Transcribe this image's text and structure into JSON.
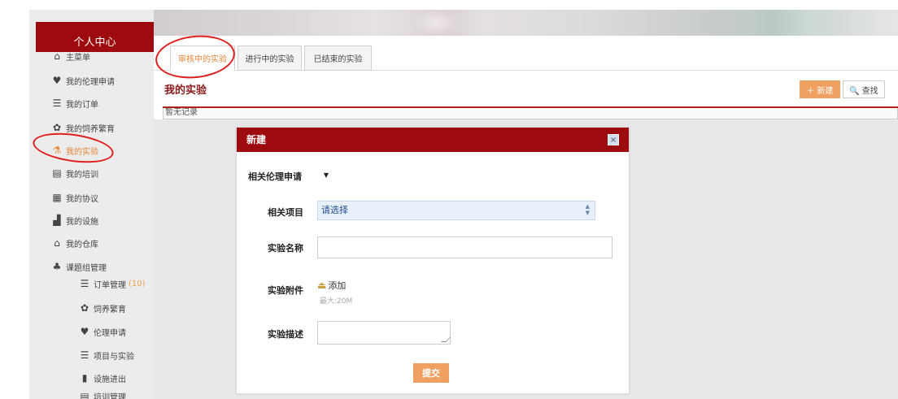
{
  "sidebar": {
    "title": "个人中心",
    "items": [
      {
        "label": "主菜单",
        "icon": "home-icon",
        "glyph": "⌂",
        "active": false
      },
      {
        "label": "我的伦理申请",
        "icon": "heart-hands-icon",
        "glyph": "♥",
        "active": false
      },
      {
        "label": "我的订单",
        "icon": "order-list-icon",
        "glyph": "☰",
        "active": false
      },
      {
        "label": "我的饲养繁育",
        "icon": "animal-icon",
        "glyph": "✿",
        "active": false
      },
      {
        "label": "我的实验",
        "icon": "flask-icon",
        "glyph": "⚗",
        "active": true
      },
      {
        "label": "我的培训",
        "icon": "training-board-icon",
        "glyph": "▤",
        "active": false
      },
      {
        "label": "我的协议",
        "icon": "agreement-icon",
        "glyph": "▦",
        "active": false
      },
      {
        "label": "我的设施",
        "icon": "building-icon",
        "glyph": "▟",
        "active": false
      },
      {
        "label": "我的仓库",
        "icon": "warehouse-icon",
        "glyph": "⌂",
        "active": false
      },
      {
        "label": "课题组管理",
        "icon": "org-chart-icon",
        "glyph": "♣",
        "active": false
      }
    ],
    "sub_items": [
      {
        "label": "订单管理",
        "count": "(10)",
        "icon": "order-list-icon",
        "glyph": "☰"
      },
      {
        "label": "饲养繁育",
        "count": "",
        "icon": "animal-icon",
        "glyph": "✿"
      },
      {
        "label": "伦理申请",
        "count": "",
        "icon": "heart-hands-icon",
        "glyph": "♥"
      },
      {
        "label": "项目与实验",
        "count": "",
        "icon": "project-bars-icon",
        "glyph": "☰"
      },
      {
        "label": "设施进出",
        "count": "",
        "icon": "door-icon",
        "glyph": "▮"
      },
      {
        "label": "培训管理",
        "count": "",
        "icon": "training-board-icon",
        "glyph": "▤"
      }
    ]
  },
  "tabs": [
    {
      "label": "审核中的实验",
      "active": true
    },
    {
      "label": "进行中的实验",
      "active": false
    },
    {
      "label": "已结束的实验",
      "active": false
    }
  ],
  "main": {
    "title": "我的实验",
    "new_button": "＋ 新建",
    "search_button": "🔍 查找",
    "empty_text": "暂无记录"
  },
  "modal": {
    "title": "新建",
    "close": "×",
    "fields": {
      "ethics_label": "相关伦理申请",
      "project_label": "相关项目",
      "project_value": "请选择",
      "name_label": "实验名称",
      "attach_label": "实验附件",
      "attach_action": "添加",
      "attach_hint": "最大:20M",
      "desc_label": "实验描述"
    },
    "submit": "提交"
  },
  "colors": {
    "brand_red": "#9e0b0f",
    "accent_orange": "#f0a060",
    "annotation_red": "#e0201e"
  }
}
